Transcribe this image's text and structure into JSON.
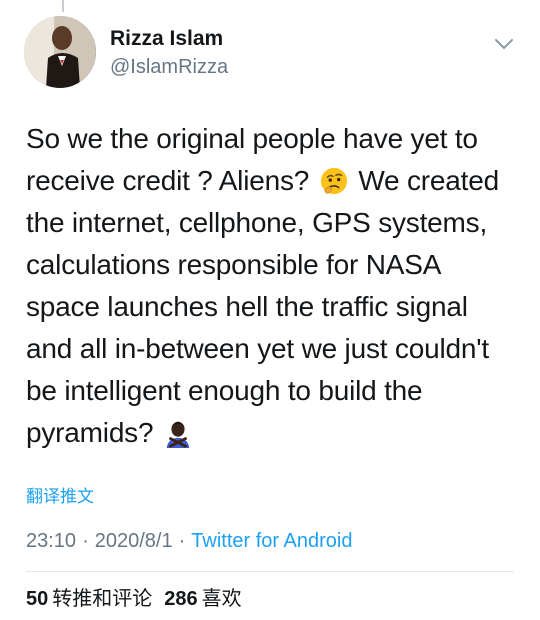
{
  "author": {
    "name": "Rizza Islam",
    "handle": "@IslamRizza"
  },
  "tweet": {
    "text_part1": "So we the original  people have yet to receive credit ? Aliens?",
    "text_part2": "We created the internet, cellphone, GPS systems, calculations responsible for NASA space launches hell the traffic signal and all in-between yet we just couldn't be intelligent enough to build the pyramids?",
    "emoji_1": "thinking-face-icon",
    "emoji_2": "man-gesturing-no-icon"
  },
  "translate_label": "翻译推文",
  "meta": {
    "time": "23:10",
    "separator": "·",
    "date": "2020/8/1",
    "source": "Twitter for Android"
  },
  "stats": {
    "retweets_count": "50",
    "retweets_label": "转推和评论",
    "likes_count": "286",
    "likes_label": "喜欢"
  },
  "colors": {
    "accent": "#1da1f2",
    "secondary_text": "#657786",
    "primary_text": "#14171a",
    "divider": "#e1e8ed"
  }
}
